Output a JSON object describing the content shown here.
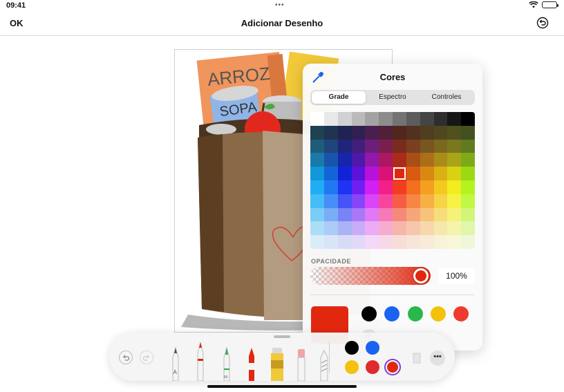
{
  "status": {
    "time": "09:41",
    "dots": "•••"
  },
  "nav": {
    "ok_label": "OK",
    "title": "Adicionar Desenho"
  },
  "drawing": {
    "label_rice": "ARROZ",
    "label_soup": "SOPA"
  },
  "colors_popover": {
    "title": "Cores",
    "tabs": [
      {
        "label": "Grade",
        "active": true
      },
      {
        "label": "Espectro",
        "active": false
      },
      {
        "label": "Controles",
        "active": false
      }
    ],
    "opacity_label": "OPACIDADE",
    "opacity_value": "100%",
    "opacity_fraction": 1.0,
    "current_color": "#e1280f",
    "saved_swatches": [
      "#000000",
      "#1a63f0",
      "#28b84c",
      "#f4c20d",
      "#f03a2e"
    ],
    "add_label": "+"
  },
  "palette": {
    "swatches": [
      "#000000",
      "#1a63f0",
      "#f4c20d",
      "#e02b2b",
      "#e1280f"
    ],
    "selected_swatch": 4,
    "more_label": "•••",
    "pen_label": "A",
    "marker_label": "50"
  }
}
